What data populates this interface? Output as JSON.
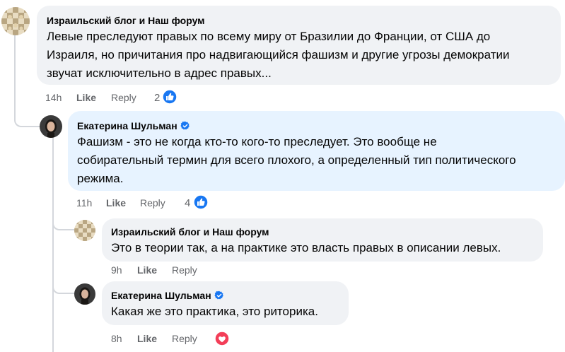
{
  "comments": [
    {
      "author": "Израильский блог и Наш форум",
      "lines": [
        "Левые преследуют правых по всему миру от Бразилии до Франции, от США до",
        "Израиля, но причитания про надвигающийся фашизм и другие угрозы демократии",
        "звучат исключительно в адрес правых..."
      ],
      "time": "14h",
      "like": "Like",
      "reply": "Reply",
      "reactions": "2",
      "reaction_icon": "thumbs-up-icon"
    },
    {
      "author": "Екатерина Шульман",
      "verified": true,
      "lines": [
        "Фашизм - это не когда кто-то кого-то преследует. Это вообще не",
        "собирательный термин для всего плохого, а определенный тип политического",
        "режима."
      ],
      "time": "11h",
      "like": "Like",
      "reply": "Reply",
      "reactions": "4",
      "reaction_icon": "thumbs-up-icon"
    },
    {
      "author": "Израильский блог и Наш форум",
      "lines": [
        "Это в теории так, а на практике это власть правых в описании левых."
      ],
      "time": "9h",
      "like": "Like",
      "reply": "Reply"
    },
    {
      "author": "Екатерина Шульман",
      "verified": true,
      "lines": [
        "Какая же это практика, это риторика."
      ],
      "time": "8h",
      "like": "Like",
      "reply": "Reply",
      "reaction_icon": "heart-icon"
    }
  ],
  "colors": {
    "bubble": "#f0f2f5",
    "bubble_highlight": "#e7f3ff",
    "meta_text": "#65676b",
    "like_blue": "#1877f2",
    "love_red": "#f33e58"
  }
}
